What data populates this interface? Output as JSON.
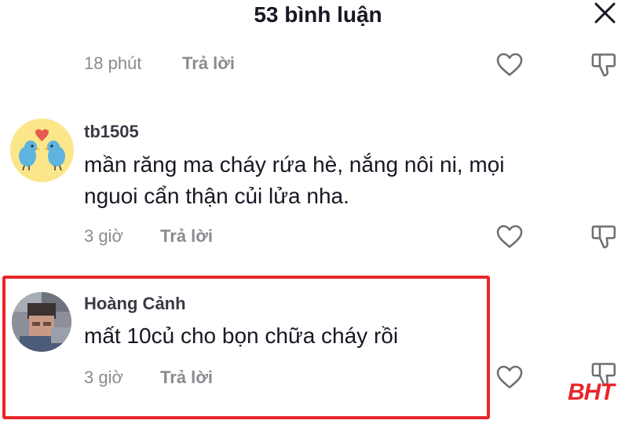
{
  "header": {
    "title": "53 bình luận",
    "close_icon": "close-icon"
  },
  "comments": [
    {
      "time": "18 phút",
      "reply": "Trả lời"
    },
    {
      "username": "tb1505",
      "text_line1": "mần răng ma cháy rứa hè, nắng nôi ni, mọi",
      "text_line2": "nguoi cẩn thận củi lửa nha.",
      "time": "3 giờ",
      "reply": "Trả lời"
    },
    {
      "username": "Hoàng Cảnh",
      "text": "mất 10củ cho bọn chữa cháy rồi",
      "time": "3 giờ",
      "reply": "Trả lời"
    }
  ],
  "watermark": "BHT",
  "colors": {
    "highlight": "#e8262a",
    "meta": "#8a8b91",
    "text": "#161823"
  }
}
